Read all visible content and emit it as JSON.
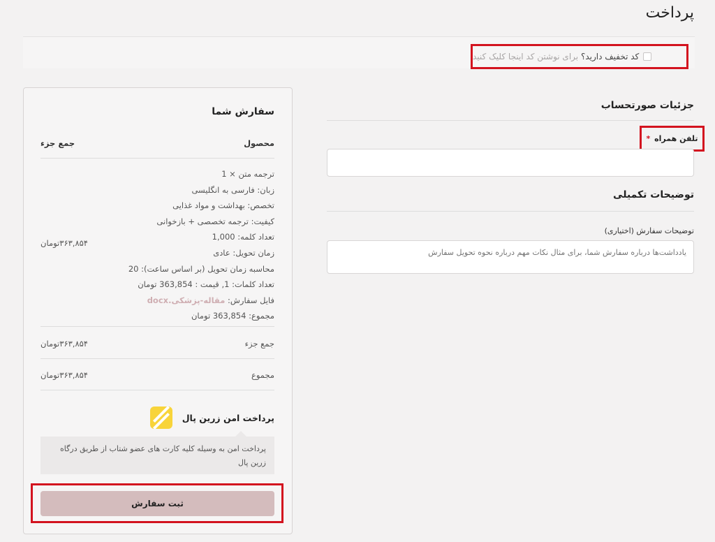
{
  "page": {
    "title": "پرداخت"
  },
  "coupon": {
    "question": "کد تخفیف دارید؟",
    "link": "برای نوشتن کد اینجا کلیک کنید"
  },
  "billing": {
    "title": "جزئیات صورتحساب",
    "phone_label": "تلفن همراه",
    "required_mark": "*",
    "phone_placeholder": ""
  },
  "extra": {
    "title": "توضیحات تکمیلی",
    "notes_label": "توضیحات سفارش (اختیاری)",
    "notes_placeholder": "یادداشت‌ها درباره سفارش شما، برای مثال نکات مهم درباره نحوه تحویل سفارش"
  },
  "order": {
    "title": "سفارش شما",
    "col_product": "محصول",
    "col_subtotal": "جمع جزء",
    "product_lines": [
      "ترجمه متن  × 1",
      "زبان: فارسی به انگلیسی",
      "تخصص: بهداشت و مواد غذایی",
      "کیفیت: ترجمه تخصصی + بازخوانی",
      "تعداد کلمه: 1,000",
      "زمان تحویل: عادی",
      "محاسبه زمان تحویل (بر اساس ساعت): 20",
      "تعداد کلمات: 1, قیمت : 363,854 تومان"
    ],
    "file_label": "فایل سفارش:",
    "file_name": "مقاله-پزشکی.docx",
    "total_line": "مجموع: 363,854 تومان",
    "product_price": "۳۶۳,۸۵۴تومان",
    "subtotal_label": "جمع جزء",
    "subtotal_value": "۳۶۳,۸۵۴تومان",
    "total_label": "مجموع",
    "total_value": "۳۶۳,۸۵۴تومان"
  },
  "payment": {
    "label": "پرداخت امن زرین پال",
    "logo_icon": "zarinpal-logo-icon",
    "description": "پرداخت امن به وسیله کلیه کارت های عضو شتاب از طریق درگاه زرین پال"
  },
  "submit": {
    "label": "ثبت سفارش"
  },
  "colors": {
    "background": "#f3f2f2",
    "highlight_border": "#d3131f",
    "submit_button": "#d4bcbd",
    "file_link": "#cfaeb2",
    "zarinpal_yellow": "#f8d43a"
  }
}
